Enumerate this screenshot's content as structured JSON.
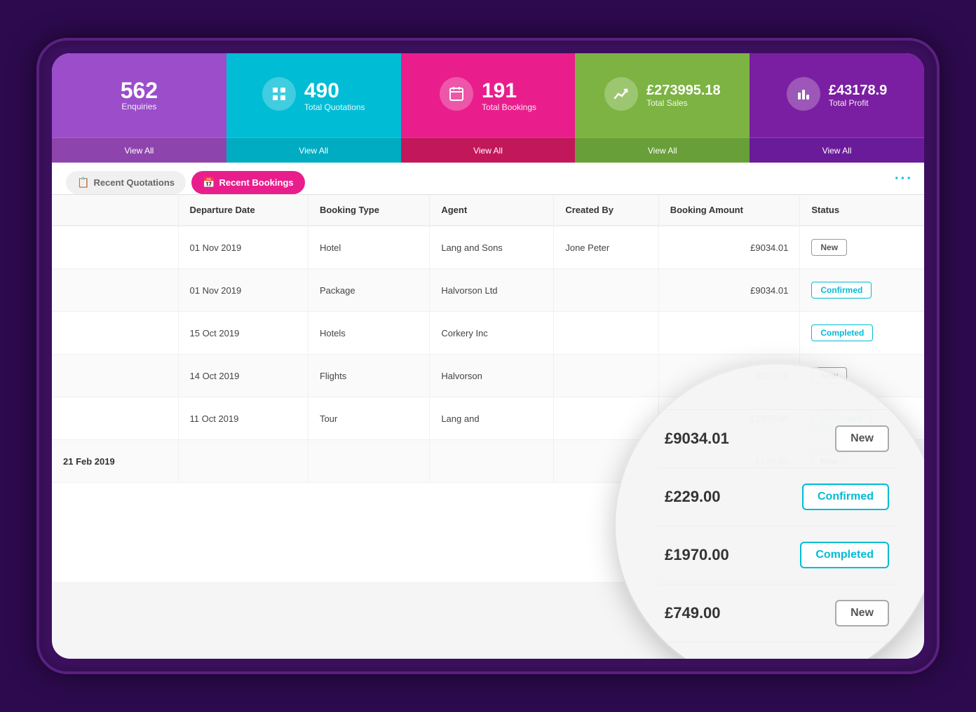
{
  "stats": [
    {
      "id": "enquiries",
      "number": "562",
      "label": "Enquiries",
      "color": "purple",
      "viewAll": "View All",
      "hasIcon": false
    },
    {
      "id": "quotations",
      "number": "490",
      "label": "Total Quotations",
      "color": "cyan",
      "viewAll": "View All",
      "icon": "grid"
    },
    {
      "id": "bookings",
      "number": "191",
      "label": "Total Bookings",
      "color": "pink",
      "viewAll": "View All",
      "icon": "calendar"
    },
    {
      "id": "sales",
      "number": "£273995.18",
      "label": "Total Sales",
      "color": "green",
      "viewAll": "View All",
      "icon": "chart"
    },
    {
      "id": "profit",
      "number": "£43178.9",
      "label": "Total Profit",
      "color": "violet",
      "viewAll": "View All",
      "icon": "bar"
    }
  ],
  "tabs": [
    {
      "id": "recent-quotations",
      "label": "Recent Quotations",
      "active": false,
      "icon": "📋"
    },
    {
      "id": "recent-bookings",
      "label": "Recent Bookings",
      "active": true,
      "icon": "📅"
    }
  ],
  "table": {
    "columns": [
      "",
      "Departure Date",
      "Booking Type",
      "Agent",
      "Created By",
      "Booking Amount",
      "Status"
    ],
    "rows": [
      {
        "id": 1,
        "name": "",
        "departure": "01 Nov 2019",
        "type": "Hotel",
        "agent": "Lang and Sons",
        "createdBy": "Jone Peter",
        "amount": "£9034.01",
        "status": "New",
        "statusClass": "status-new"
      },
      {
        "id": 2,
        "name": "",
        "departure": "01 Nov 2019",
        "type": "Package",
        "agent": "Halvorson Ltd",
        "createdBy": "",
        "amount": "£9034.01",
        "status": "Confirmed",
        "statusClass": "status-confirmed"
      },
      {
        "id": 3,
        "name": "",
        "departure": "15 Oct 2019",
        "type": "Hotels",
        "agent": "Corkery Inc",
        "createdBy": "",
        "amount": "",
        "status": "Completed",
        "statusClass": "status-completed"
      },
      {
        "id": 4,
        "name": "",
        "departure": "14 Oct 2019",
        "type": "Flights",
        "agent": "Halvorson",
        "createdBy": "",
        "amount": "£229.00",
        "status": "New",
        "statusClass": "status-new"
      },
      {
        "id": 5,
        "name": "",
        "departure": "11 Oct 2019",
        "type": "Tour",
        "agent": "Lang and",
        "createdBy": "",
        "amount": "£1970.00",
        "status": "Confirmed",
        "statusClass": "status-confirmed"
      },
      {
        "id": 6,
        "name": "21 Feb 2019",
        "departure": "",
        "type": "",
        "agent": "",
        "createdBy": "",
        "amount": "£749.00",
        "status": "New",
        "statusClass": "status-new"
      }
    ]
  },
  "magnifier": {
    "rows": [
      {
        "amount": "£9034.01",
        "status": "New",
        "statusClass": "mag-badge-new"
      },
      {
        "amount": "£229.00",
        "status": "Confirmed",
        "statusClass": "mag-badge-confirmed"
      },
      {
        "amount": "£1970.00",
        "status": "Completed",
        "statusClass": "mag-badge-completed"
      },
      {
        "amount": "£749.00",
        "status": "New",
        "statusClass": "mag-badge-new"
      }
    ]
  },
  "more_dots": "···"
}
